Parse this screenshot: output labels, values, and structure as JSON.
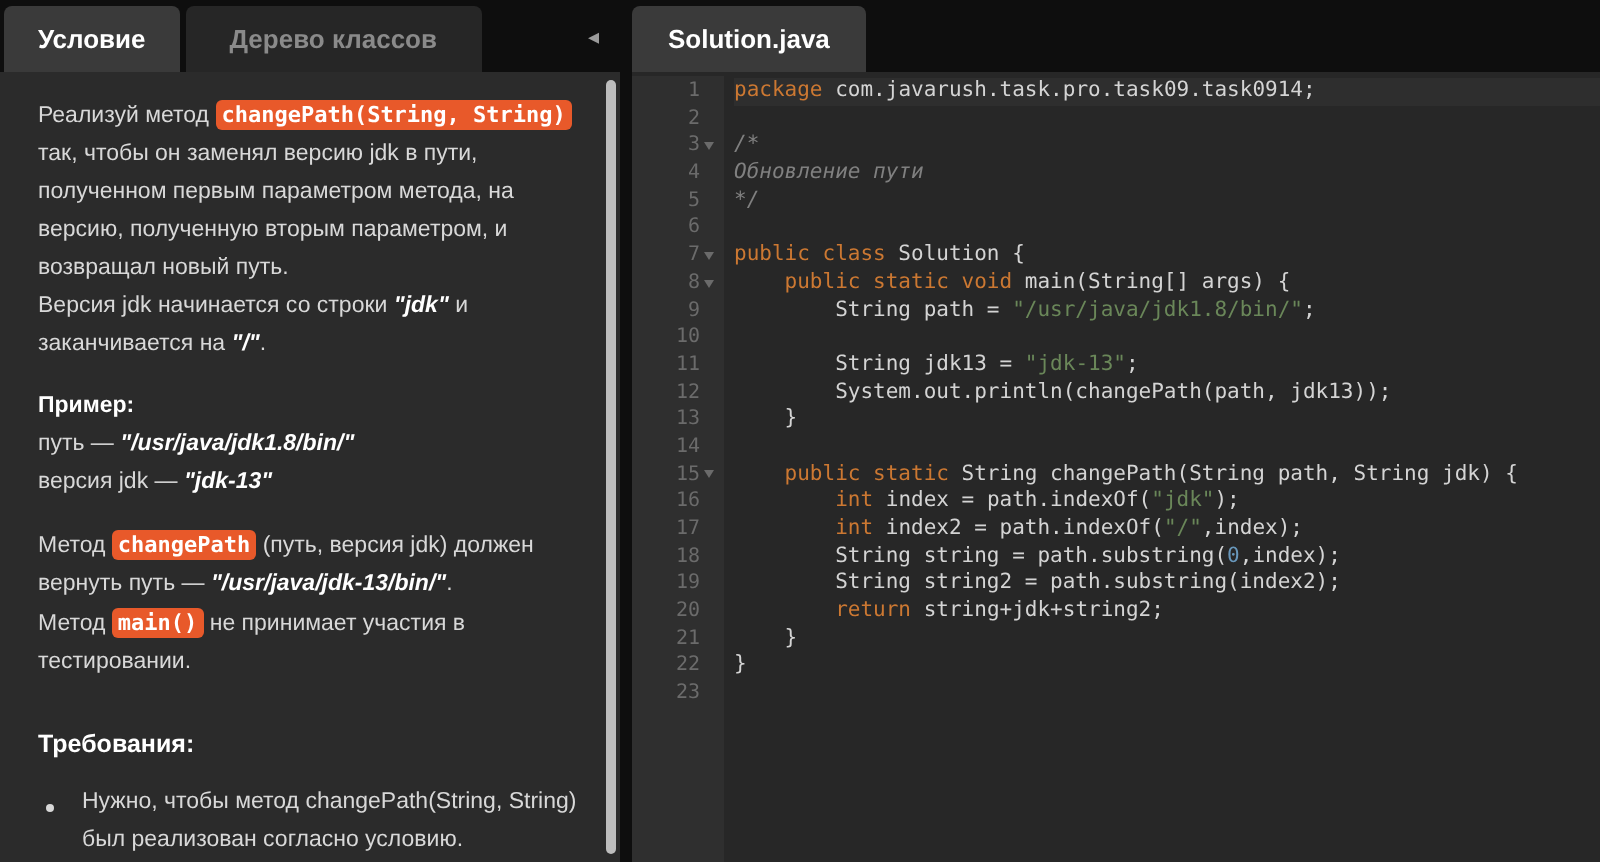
{
  "left_tabs": [
    {
      "label": "Условие",
      "selected": true
    },
    {
      "label": "Дерево классов",
      "selected": false
    }
  ],
  "collapse_icon": "◂",
  "description": [
    [
      {
        "kind": "text",
        "text": "Реализуй метод "
      },
      {
        "kind": "code",
        "text": "changePath(String, String)"
      },
      {
        "kind": "text",
        "text": " так, чтобы он заменял версию jdk в пути, полученном первым параметром метода, на версию, полученную вторым параметром, и возвращал новый путь."
      },
      {
        "kind": "br"
      },
      {
        "kind": "text",
        "text": "Версия jdk начинается со строки "
      },
      {
        "kind": "em",
        "text": "\"jdk\""
      },
      {
        "kind": "text",
        "text": " и заканчивается на "
      },
      {
        "kind": "em",
        "text": "\"/\""
      },
      {
        "kind": "text",
        "text": "."
      }
    ],
    [
      {
        "kind": "strong",
        "text": "Пример:"
      },
      {
        "kind": "br"
      },
      {
        "kind": "text",
        "text": "путь — "
      },
      {
        "kind": "em",
        "text": "\"/usr/java/jdk1.8/bin/\""
      },
      {
        "kind": "br"
      },
      {
        "kind": "text",
        "text": "версия jdk — "
      },
      {
        "kind": "em",
        "text": "\"jdk-13\""
      }
    ],
    [
      {
        "kind": "text",
        "text": "Метод "
      },
      {
        "kind": "code",
        "text": "changePath"
      },
      {
        "kind": "text",
        "text": " (путь, версия jdk) должен вернуть путь — "
      },
      {
        "kind": "em",
        "text": "\"/usr/java/jdk-13/bin/\""
      },
      {
        "kind": "text",
        "text": "."
      },
      {
        "kind": "br"
      },
      {
        "kind": "text",
        "text": "Метод "
      },
      {
        "kind": "code",
        "text": "main()"
      },
      {
        "kind": "text",
        "text": " не принимает участия в тестировании."
      }
    ]
  ],
  "requirements": {
    "title": "Требования:",
    "items": [
      "Нужно, чтобы метод changePath(String, String) был реализован согласно условию."
    ]
  },
  "editor_tabs": [
    {
      "label": "Solution.java",
      "selected": true
    }
  ],
  "code_lines": [
    {
      "number": "1",
      "foldable": false,
      "tokens": [
        {
          "kind": "kw",
          "text": "package"
        },
        {
          "kind": "plain",
          "text": " com.javarush.task.pro.task09.task0914;"
        }
      ]
    },
    {
      "number": "2",
      "foldable": false
    },
    {
      "number": "3",
      "foldable": true,
      "tokens": [
        {
          "kind": "comment",
          "text": "/*"
        }
      ]
    },
    {
      "number": "4",
      "foldable": false,
      "tokens": [
        {
          "kind": "comment",
          "text": "Обновление пути"
        }
      ]
    },
    {
      "number": "5",
      "foldable": false,
      "tokens": [
        {
          "kind": "comment",
          "text": "*/"
        }
      ]
    },
    {
      "number": "6",
      "foldable": false
    },
    {
      "number": "7",
      "foldable": true,
      "tokens": [
        {
          "kind": "kw",
          "text": "public class"
        },
        {
          "kind": "plain",
          "text": " Solution {"
        }
      ]
    },
    {
      "number": "8",
      "foldable": true,
      "tokens": [
        {
          "kind": "kw",
          "text": "    public static void"
        },
        {
          "kind": "plain",
          "text": " main(String[] args) {"
        }
      ]
    },
    {
      "number": "9",
      "foldable": false,
      "tokens": [
        {
          "kind": "plain",
          "text": "        String path = "
        },
        {
          "kind": "str",
          "text": "\"/usr/java/jdk1.8/bin/\""
        },
        {
          "kind": "plain",
          "text": ";"
        }
      ]
    },
    {
      "number": "10",
      "foldable": false
    },
    {
      "number": "11",
      "foldable": false,
      "tokens": [
        {
          "kind": "plain",
          "text": "        String jdk13 = "
        },
        {
          "kind": "str",
          "text": "\"jdk-13\""
        },
        {
          "kind": "plain",
          "text": ";"
        }
      ]
    },
    {
      "number": "12",
      "foldable": false,
      "tokens": [
        {
          "kind": "plain",
          "text": "        System.out.println(changePath(path, jdk13));"
        }
      ]
    },
    {
      "number": "13",
      "foldable": false,
      "tokens": [
        {
          "kind": "plain",
          "text": "    }"
        }
      ]
    },
    {
      "number": "14",
      "foldable": false
    },
    {
      "number": "15",
      "foldable": true,
      "tokens": [
        {
          "kind": "kw",
          "text": "    public static"
        },
        {
          "kind": "plain",
          "text": " String changePath(String path, String jdk) {"
        }
      ]
    },
    {
      "number": "16",
      "foldable": false,
      "tokens": [
        {
          "kind": "kw",
          "text": "        int"
        },
        {
          "kind": "plain",
          "text": " index = path.indexOf("
        },
        {
          "kind": "str",
          "text": "\"jdk\""
        },
        {
          "kind": "plain",
          "text": ");"
        }
      ]
    },
    {
      "number": "17",
      "foldable": false,
      "tokens": [
        {
          "kind": "kw",
          "text": "        int"
        },
        {
          "kind": "plain",
          "text": " index2 = path.indexOf("
        },
        {
          "kind": "str",
          "text": "\"/\""
        },
        {
          "kind": "plain",
          "text": ",index);"
        }
      ]
    },
    {
      "number": "18",
      "foldable": false,
      "tokens": [
        {
          "kind": "plain",
          "text": "        String string = path.substring("
        },
        {
          "kind": "num",
          "text": "0"
        },
        {
          "kind": "plain",
          "text": ",index);"
        }
      ]
    },
    {
      "number": "19",
      "foldable": false,
      "tokens": [
        {
          "kind": "plain",
          "text": "        String string2 = path.substring(index2);"
        }
      ]
    },
    {
      "number": "20",
      "foldable": false,
      "tokens": [
        {
          "kind": "kw",
          "text": "        return"
        },
        {
          "kind": "plain",
          "text": " string+jdk+string2;"
        }
      ]
    },
    {
      "number": "21",
      "foldable": false,
      "tokens": [
        {
          "kind": "plain",
          "text": "    }"
        }
      ]
    },
    {
      "number": "22",
      "foldable": false,
      "tokens": [
        {
          "kind": "plain",
          "text": "}"
        }
      ]
    },
    {
      "number": "23",
      "foldable": false
    }
  ]
}
